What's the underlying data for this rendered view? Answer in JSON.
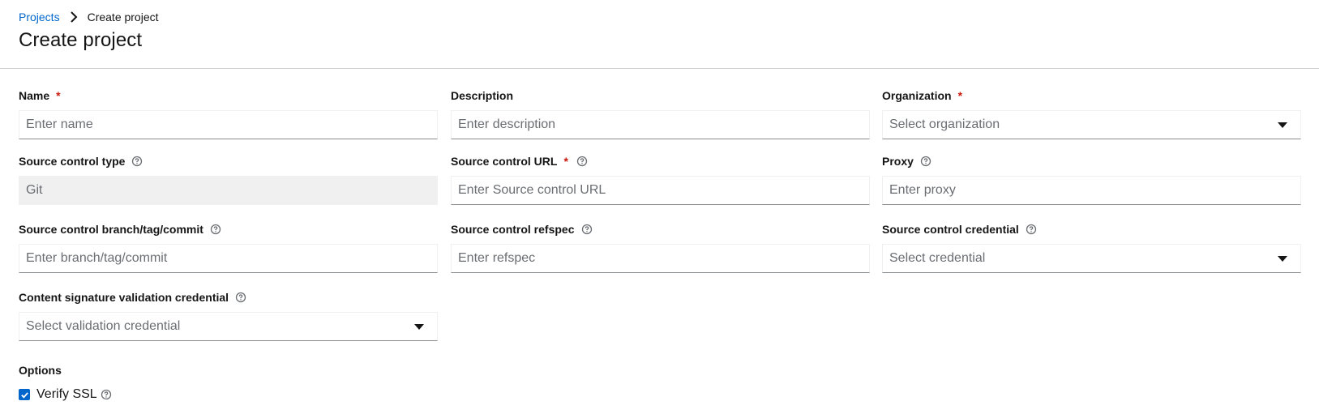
{
  "breadcrumb": {
    "parent": "Projects",
    "current": "Create project"
  },
  "page_title": "Create project",
  "required_marker": "*",
  "form": {
    "name": {
      "label": "Name",
      "placeholder": "Enter name"
    },
    "description": {
      "label": "Description",
      "placeholder": "Enter description"
    },
    "organization": {
      "label": "Organization",
      "placeholder": "Select organization"
    },
    "source_control_type": {
      "label": "Source control type",
      "value": "Git"
    },
    "source_control_url": {
      "label": "Source control URL",
      "placeholder": "Enter Source control URL"
    },
    "proxy": {
      "label": "Proxy",
      "placeholder": "Enter proxy"
    },
    "branch": {
      "label": "Source control branch/tag/commit",
      "placeholder": "Enter branch/tag/commit"
    },
    "refspec": {
      "label": "Source control refspec",
      "placeholder": "Enter refspec"
    },
    "credential": {
      "label": "Source control credential",
      "placeholder": "Select credential"
    },
    "signature_credential": {
      "label": "Content signature validation credential",
      "placeholder": "Select validation credential"
    }
  },
  "options": {
    "label": "Options",
    "verify_ssl": {
      "label": "Verify SSL",
      "checked": true
    }
  },
  "colors": {
    "link": "#0066cc",
    "required": "#c9190b",
    "checkbox": "#0066cc"
  },
  "icons": {
    "help": "help-circle-icon",
    "caret": "caret-down-icon",
    "separator": "angle-right-icon",
    "check": "check-icon"
  }
}
